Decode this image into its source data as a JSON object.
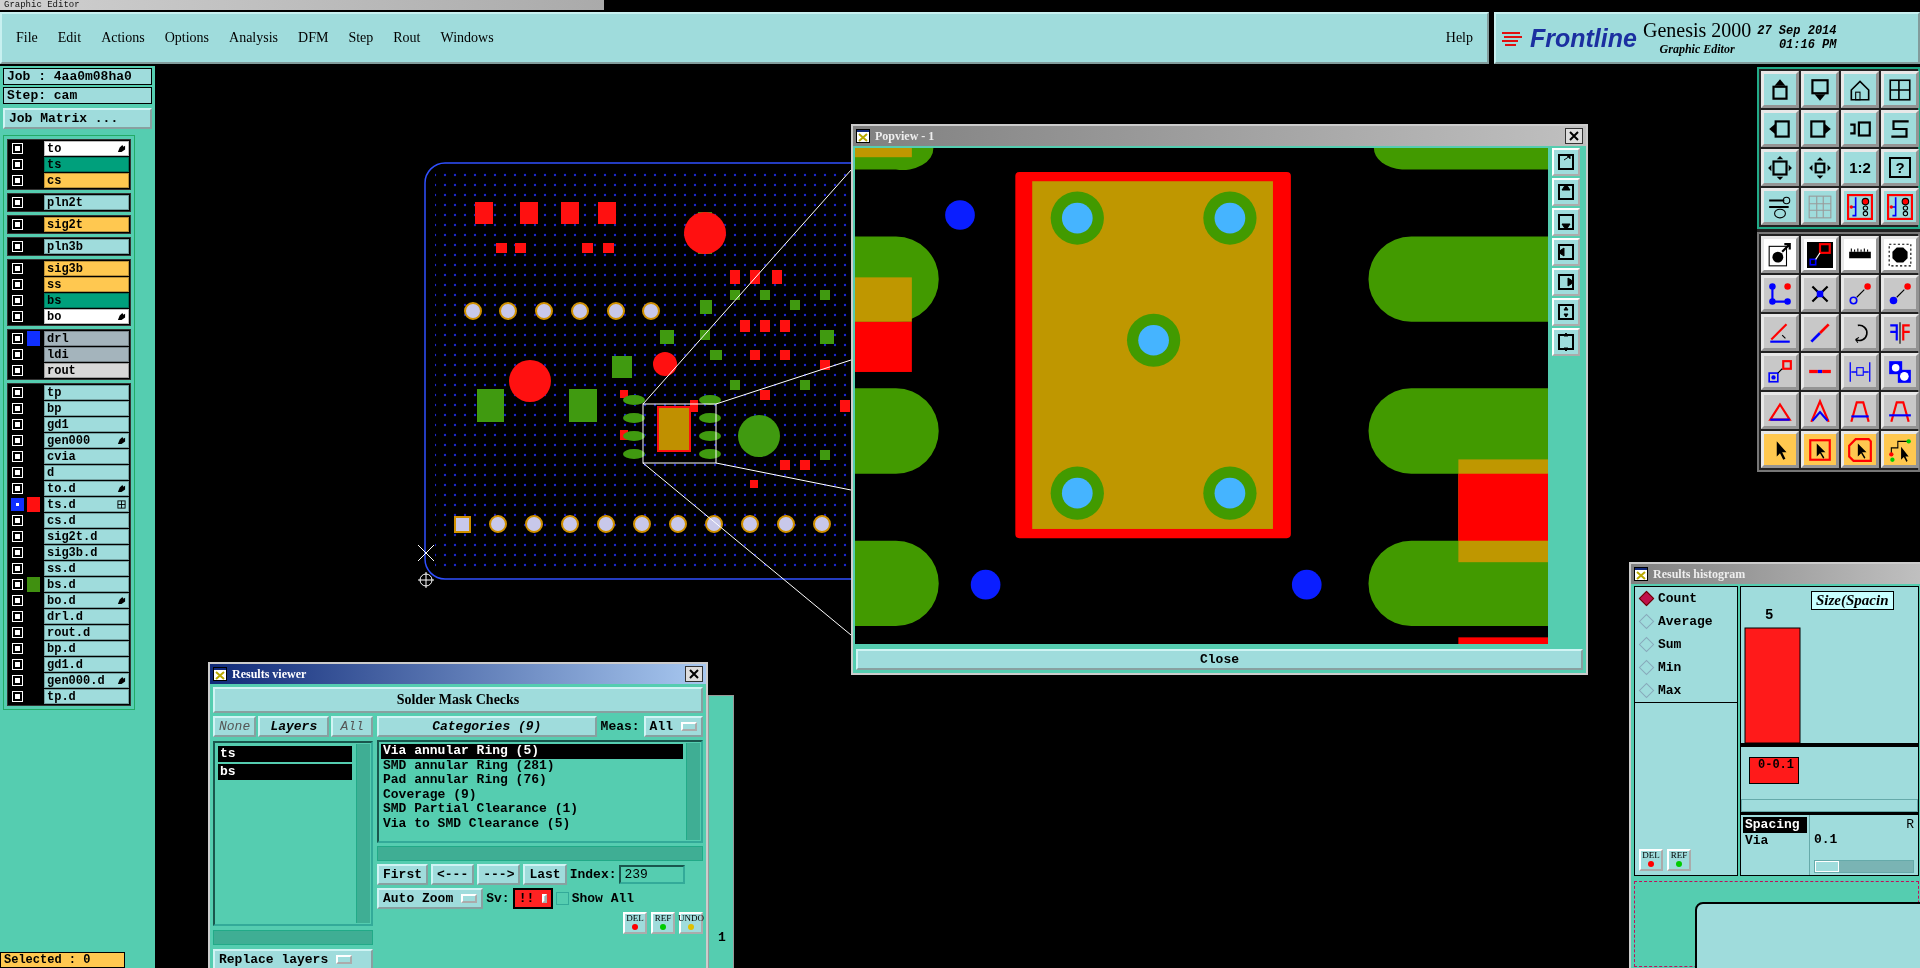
{
  "title_bar": {
    "title": "Graphic Editor"
  },
  "menu": {
    "items": [
      "File",
      "Edit",
      "Actions",
      "Options",
      "Analysis",
      "DFM",
      "Step",
      "Rout",
      "Windows"
    ],
    "help": "Help"
  },
  "brand": {
    "logo": "Frontline",
    "product": "Genesis 2000",
    "subtitle": "Graphic Editor",
    "date": "27 Sep 2014",
    "time": "01:16 PM"
  },
  "job_panel": {
    "job": "Job : 4aa0m08ha0",
    "step": "Step: cam",
    "matrix_button": "Job Matrix ...",
    "layer_groups": [
      [
        {
          "name": "to",
          "kind": "component",
          "affected": true,
          "work": false,
          "selected": false
        },
        {
          "name": "ts",
          "kind": "mask",
          "affected": false,
          "work": false,
          "selected": false
        },
        {
          "name": "cs",
          "kind": "signal",
          "affected": false,
          "work": false,
          "selected": false
        }
      ],
      [
        {
          "name": "pln2t",
          "kind": "plane",
          "affected": false,
          "work": false,
          "selected": false
        }
      ],
      [
        {
          "name": "sig2t",
          "kind": "signal",
          "affected": false,
          "work": false,
          "selected": false
        }
      ],
      [
        {
          "name": "pln3b",
          "kind": "plane",
          "affected": false,
          "work": false,
          "selected": false
        }
      ],
      [
        {
          "name": "sig3b",
          "kind": "signal",
          "affected": false,
          "work": false,
          "selected": false
        },
        {
          "name": "ss",
          "kind": "signal",
          "affected": false,
          "work": false,
          "selected": false
        },
        {
          "name": "bs",
          "kind": "mask",
          "affected": false,
          "work": false,
          "selected": false
        },
        {
          "name": "bo",
          "kind": "component",
          "affected": true,
          "work": false,
          "selected": false
        }
      ],
      [
        {
          "name": "drl",
          "kind": "drill",
          "color": "#1030ff",
          "affected": false,
          "work": false,
          "selected": false
        },
        {
          "name": "ldi",
          "kind": "drill",
          "affected": false,
          "work": false,
          "selected": false
        },
        {
          "name": "rout",
          "kind": "rout",
          "affected": false,
          "work": false,
          "selected": false
        }
      ],
      [
        {
          "name": "tp",
          "kind": "misc",
          "affected": false,
          "work": false,
          "selected": false
        },
        {
          "name": "bp",
          "kind": "misc",
          "affected": false,
          "work": false,
          "selected": false
        },
        {
          "name": "gd1",
          "kind": "misc",
          "affected": false,
          "work": false,
          "selected": false
        },
        {
          "name": "gen000",
          "kind": "misc",
          "affected": true,
          "work": false,
          "selected": false
        },
        {
          "name": "cvia",
          "kind": "misc",
          "affected": false,
          "work": false,
          "selected": false
        },
        {
          "name": "d",
          "kind": "misc",
          "affected": false,
          "work": false,
          "selected": false
        },
        {
          "name": "to.d",
          "kind": "misc",
          "affected": true,
          "work": false,
          "selected": false
        },
        {
          "name": "ts.d",
          "kind": "misc",
          "color": "#ff1010",
          "affected": false,
          "work": true,
          "selected": true
        },
        {
          "name": "cs.d",
          "kind": "misc",
          "affected": false,
          "work": false,
          "selected": false
        },
        {
          "name": "sig2t.d",
          "kind": "misc",
          "affected": false,
          "work": false,
          "selected": false
        },
        {
          "name": "sig3b.d",
          "kind": "misc",
          "affected": false,
          "work": false,
          "selected": false
        },
        {
          "name": "ss.d",
          "kind": "misc",
          "affected": false,
          "work": false,
          "selected": false
        },
        {
          "name": "bs.d",
          "kind": "misc",
          "color": "#409010",
          "affected": false,
          "work": false,
          "selected": false
        },
        {
          "name": "bo.d",
          "kind": "misc",
          "affected": true,
          "work": false,
          "selected": false
        },
        {
          "name": "drl.d",
          "kind": "misc",
          "affected": false,
          "work": false,
          "selected": false
        },
        {
          "name": "rout.d",
          "kind": "misc",
          "affected": false,
          "work": false,
          "selected": false
        },
        {
          "name": "bp.d",
          "kind": "misc",
          "affected": false,
          "work": false,
          "selected": false
        },
        {
          "name": "gd1.d",
          "kind": "misc",
          "affected": false,
          "work": false,
          "selected": false
        },
        {
          "name": "gen000.d",
          "kind": "misc",
          "affected": true,
          "work": false,
          "selected": false
        },
        {
          "name": "tp.d",
          "kind": "misc",
          "affected": false,
          "work": false,
          "selected": false
        }
      ]
    ],
    "status": "Selected : 0"
  },
  "toolbar": {
    "ratio_button": "1:2",
    "help_button": "?"
  },
  "popview": {
    "title": "Popview - 1",
    "close_button": "Close"
  },
  "results_viewer": {
    "title": "Results viewer",
    "heading": "Solder Mask Checks",
    "layer_filters": [
      {
        "label": "None",
        "disabled": true
      },
      {
        "label": "Layers",
        "disabled": false
      },
      {
        "label": "All",
        "disabled": true
      }
    ],
    "layers": [
      {
        "name": "ts",
        "selected": true
      },
      {
        "name": "bs",
        "selected": true
      }
    ],
    "replace_dropdown": "Replace layers",
    "categories_button": "Categories (9)",
    "meas_label": "Meas:",
    "meas_value": "All",
    "categories": [
      {
        "label": "Via annular Ring (5)",
        "selected": true
      },
      {
        "label": "SMD annular Ring (281)",
        "selected": false
      },
      {
        "label": "Pad annular Ring (76)",
        "selected": false
      },
      {
        "label": "Coverage (9)",
        "selected": false
      },
      {
        "label": "SMD Partial Clearance (1)",
        "selected": false
      },
      {
        "label": "Via to SMD Clearance (5)",
        "selected": false
      }
    ],
    "nav_buttons": [
      "First",
      "<---",
      "--->",
      "Last"
    ],
    "index_label": "Index:",
    "index_value": "239",
    "zoom_dropdown": "Auto Zoom",
    "sv_label": "Sv:",
    "sv_value": "!!",
    "show_all": {
      "label": "Show All",
      "checked": false
    },
    "action_buttons": [
      {
        "label": "DEL",
        "kind": "delete"
      },
      {
        "label": "REF",
        "kind": "refresh"
      },
      {
        "label": "UNDO",
        "kind": "undo"
      }
    ],
    "behind_window_text": "1"
  },
  "results_histogram": {
    "title": "Results histogram",
    "modes": [
      {
        "label": "Count",
        "selected": true
      },
      {
        "label": "Average",
        "selected": false
      },
      {
        "label": "Sum",
        "selected": false
      },
      {
        "label": "Min",
        "selected": false
      },
      {
        "label": "Max",
        "selected": false
      }
    ],
    "action_buttons": [
      {
        "label": "DEL",
        "kind": "delete"
      },
      {
        "label": "REF",
        "kind": "refresh"
      }
    ],
    "chart_title": "Size(Spacin",
    "bar_value_label": "5",
    "bin_label": "0-0.1",
    "measures": [
      {
        "label": "Spacing",
        "selected": true
      },
      {
        "label": "Via",
        "selected": false
      }
    ],
    "range_label": "R",
    "range_value": "0.1",
    "range_slider": {
      "level": 0
    }
  }
}
